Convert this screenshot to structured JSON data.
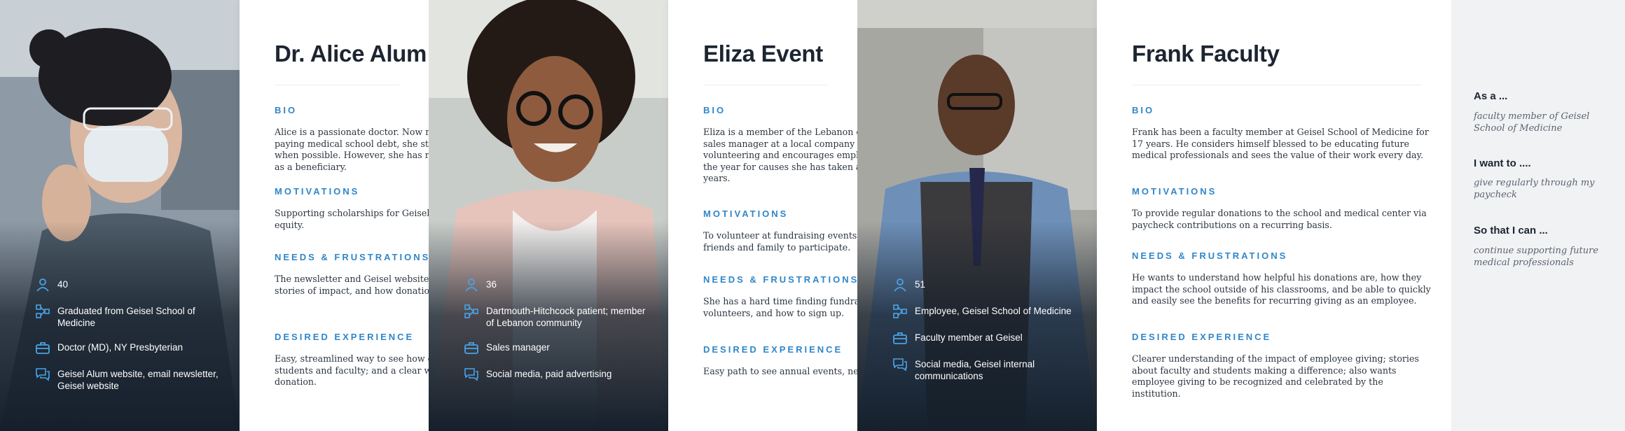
{
  "personas": [
    {
      "name": "Dr. Alice Alum",
      "bio": "Alice is a passionate doctor. Now married, she grew up while paying medical school debt, she still makes small annual gifts when possible. However, she has recently explored naming Geisel as a beneficiary.",
      "motivations": "Supporting scholarships for Geisel students and improving health equity.",
      "needs": "The newsletter and Geisel website are useful, but she wants more stories of impact, and how donations are used.",
      "experience": "Easy, streamlined way to see how gifts help; updates from Geisel students and faculty; and a clear way to set up a recurring donation.",
      "facts": [
        {
          "icon": "person-icon",
          "text": "40"
        },
        {
          "icon": "network-icon",
          "text": "Graduated from Geisel School of Medicine"
        },
        {
          "icon": "briefcase-icon",
          "text": "Doctor (MD), NY Presbyterian"
        },
        {
          "icon": "chat-icon",
          "text": "Geisel Alum website, email newsletter, Geisel website"
        }
      ]
    },
    {
      "name": "Eliza Event",
      "bio": "Eliza is a member of the Lebanon community. She's a successful sales manager at a local company and has family here. She loves volunteering and encourages employees to take time off during the year for causes she has taken advantage of for the last four years.",
      "motivations": "To volunteer at fundraising events at Geisel and to encourage friends and family to participate.",
      "needs": "She has a hard time finding fundraising events that need volunteers, and how to sign up.",
      "experience": "Easy path to see annual events, needs, and volunteer.",
      "facts": [
        {
          "icon": "person-icon",
          "text": "36"
        },
        {
          "icon": "network-icon",
          "text": "Dartmouth-Hitchcock patient; member of Lebanon community"
        },
        {
          "icon": "briefcase-icon",
          "text": "Sales manager"
        },
        {
          "icon": "chat-icon",
          "text": "Social media, paid advertising"
        }
      ]
    },
    {
      "name": "Frank Faculty",
      "bio": "Frank has been a faculty member at Geisel School of Medicine for 17 years. He considers himself blessed to be educating future medical professionals and sees the value of their work every day.",
      "motivations": "To provide regular donations to the school and medical center via paycheck contributions on a recurring basis.",
      "needs": "He wants to understand how helpful his donations are, how they impact the school outside of his classrooms, and be able to quickly and easily see the benefits for recurring giving as an employee.",
      "experience": "Clearer understanding of the impact of employee giving; stories about faculty and students making a difference; also wants employee giving to be recognized and celebrated by the institution.",
      "facts": [
        {
          "icon": "person-icon",
          "text": "51"
        },
        {
          "icon": "network-icon",
          "text": "Employee, Geisel School of Medicine"
        },
        {
          "icon": "briefcase-icon",
          "text": "Faculty member at Geisel"
        },
        {
          "icon": "chat-icon",
          "text": "Social media, Geisel internal communications"
        }
      ]
    }
  ],
  "labels": {
    "bio": "BIO",
    "motivations": "MOTIVATIONS",
    "needs": "NEEDS & FRUSTRATIONS",
    "experience": "DESIRED EXPERIENCE"
  },
  "story": {
    "as_a_label": "As a ...",
    "as_a": "faculty member of Geisel School of Medicine",
    "i_want_label": "I want to ....",
    "i_want": "give regularly through my paycheck",
    "so_that_label": "So that I can ...",
    "so_that": "continue supporting future medical professionals"
  },
  "colors": {
    "accent": "#2f86c9",
    "dark": "#15202c"
  }
}
